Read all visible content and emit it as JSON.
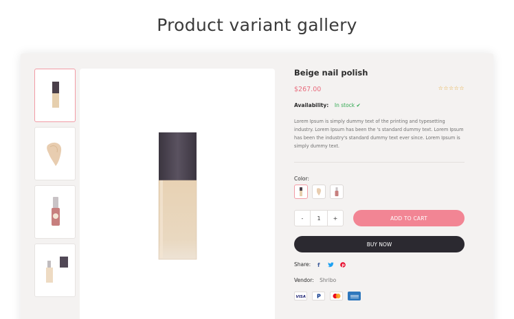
{
  "page": {
    "heading": "Product variant gallery"
  },
  "gallery": {
    "thumbnails": [
      {
        "name": "foundation-bottle",
        "active": true
      },
      {
        "name": "foundation-swatch",
        "active": false
      },
      {
        "name": "nail-polish-bottle",
        "active": false
      },
      {
        "name": "bottle-with-box",
        "active": false
      }
    ]
  },
  "product": {
    "title": "Beige nail polish",
    "price": "$267.00",
    "rating_stars": "☆☆☆☆☆",
    "availability_label": "Availability:",
    "availability_value": "In stock",
    "description": "Lorem Ipsum is simply dummy text of the printing and typesetting industry. Lorem Ipsum has been the 's standard dummy text. Lorem Ipsum has been the industry's standard dummy text ever since. Lorem Ipsum is simply dummy text.",
    "color_label": "Color:",
    "quantity": {
      "minus": "-",
      "value": "1",
      "plus": "+"
    },
    "add_to_cart": "ADD TO CART",
    "buy_now": "BUY NOW",
    "share_label": "Share:",
    "share_icons": [
      "facebook-icon",
      "twitter-icon",
      "pinterest-icon"
    ],
    "vendor_label": "Vendor:",
    "vendor_name": "Shribo",
    "payment_icons": [
      "visa-icon",
      "paypal-icon",
      "mastercard-icon",
      "amex-icon"
    ],
    "colors": {
      "accent": "#f28594",
      "price": "#e86b7c",
      "stock": "#2fa84f",
      "dark_button": "#2b2930",
      "star": "#e4a42b"
    }
  }
}
